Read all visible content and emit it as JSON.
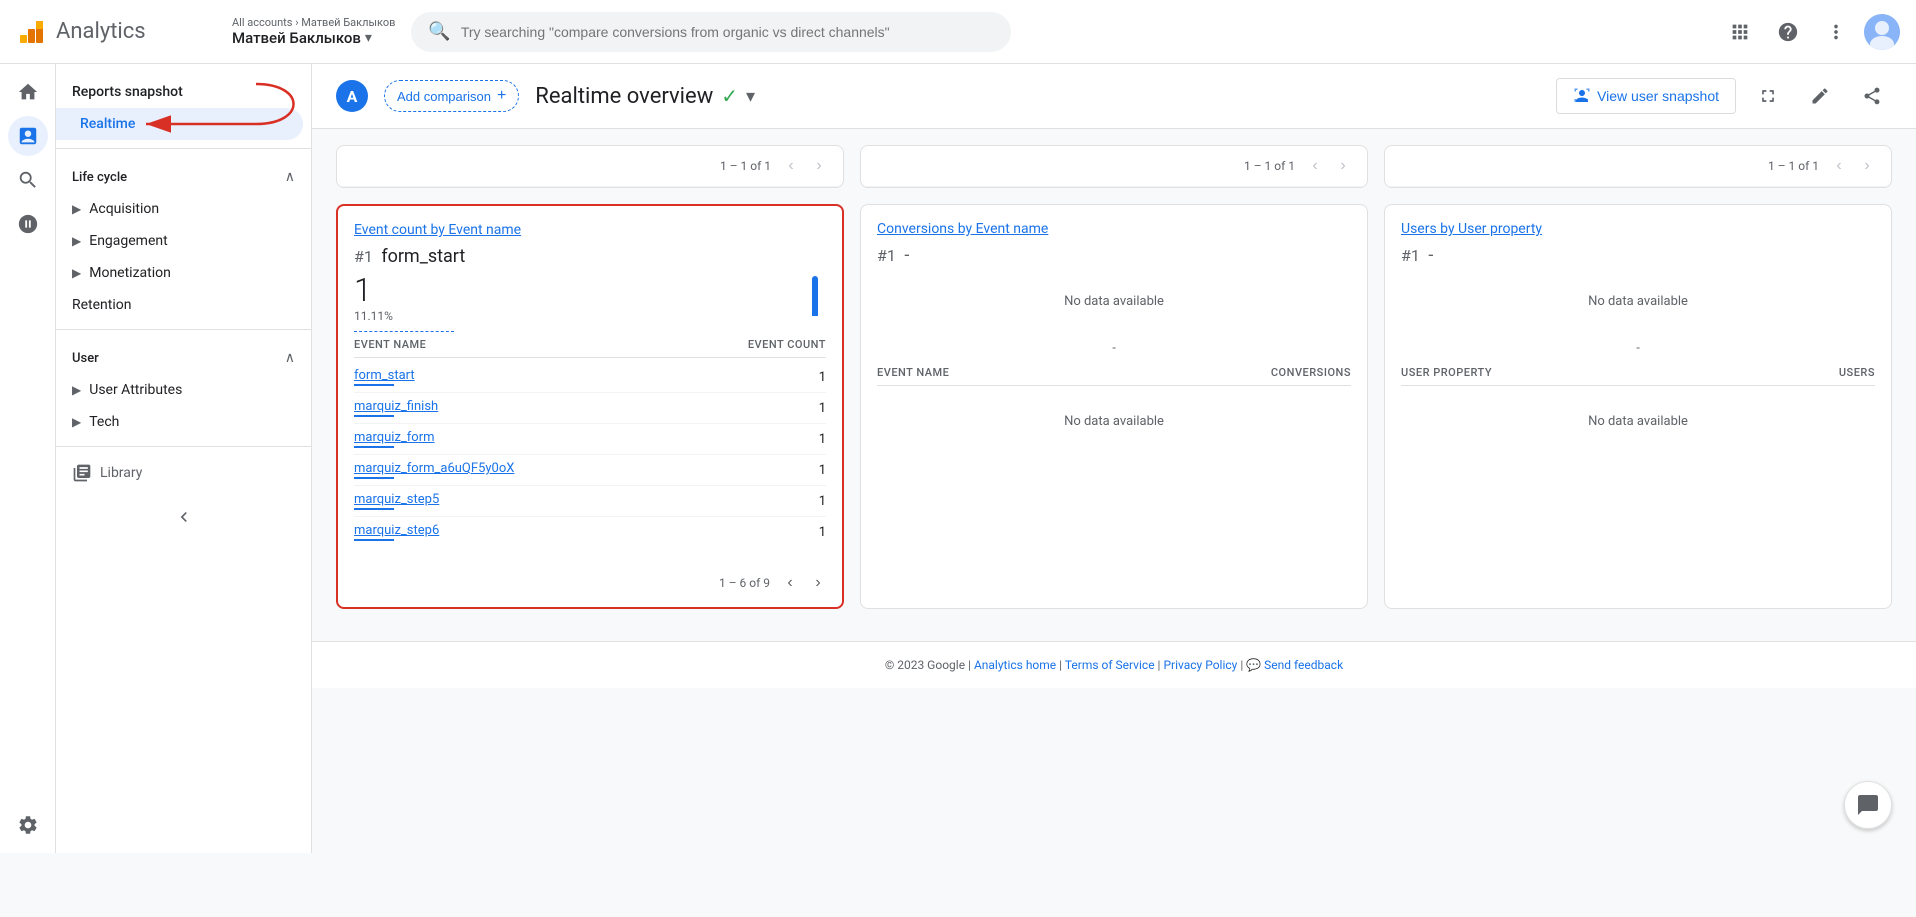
{
  "header": {
    "app_title": "Analytics",
    "breadcrumb_all": "All accounts",
    "breadcrumb_sep": "›",
    "account_name": "Матвей Баклыков",
    "account_name_arrow": "▾",
    "search_placeholder": "Try searching \"compare conversions from organic vs direct channels\"",
    "apps_icon": "⊞",
    "help_icon": "?",
    "more_icon": "⋮"
  },
  "sidebar": {
    "reports_snapshot": "Reports snapshot",
    "realtime": "Realtime",
    "lifecycle_title": "Life cycle",
    "lifecycle_items": [
      {
        "label": "Acquisition",
        "expandable": true
      },
      {
        "label": "Engagement",
        "expandable": true
      },
      {
        "label": "Monetization",
        "expandable": true
      },
      {
        "label": "Retention",
        "expandable": false
      }
    ],
    "user_title": "User",
    "user_items": [
      {
        "label": "User Attributes",
        "expandable": true
      },
      {
        "label": "Tech",
        "expandable": true
      }
    ],
    "library": "Library"
  },
  "content": {
    "add_comparison_label": "Add comparison",
    "add_comparison_icon": "+",
    "page_title": "Realtime overview",
    "view_snapshot_label": "View user snapshot",
    "cards_row1": {
      "pagination_label": "1 – 1 of 1",
      "prev_disabled": true,
      "next_disabled": true
    },
    "event_count_card": {
      "title": "Event count by Event name",
      "top_rank": "#1",
      "top_name": "form_start",
      "metric_value": "1",
      "metric_percent": "11.11%",
      "col1": "EVENT NAME",
      "col2": "EVENT COUNT",
      "rows": [
        {
          "name": "form_start",
          "value": "1"
        },
        {
          "name": "marquiz_finish",
          "value": "1"
        },
        {
          "name": "marquiz_form",
          "value": "1"
        },
        {
          "name": "marquiz_form_a6uQF5y0oX",
          "value": "1"
        },
        {
          "name": "marquiz_step5",
          "value": "1"
        },
        {
          "name": "marquiz_step6",
          "value": "1"
        }
      ],
      "footer_pagination": "1 – 6 of 9"
    },
    "conversions_card": {
      "title": "Conversions by Event name",
      "top_rank": "#1",
      "top_dash": "-",
      "col1": "EVENT NAME",
      "col2": "CONVERSIONS",
      "no_data": "No data available",
      "dash": "-"
    },
    "users_card": {
      "title": "Users by User property",
      "top_rank": "#1",
      "top_dash": "-",
      "col1": "USER PROPERTY",
      "col2": "USERS",
      "no_data": "No data available",
      "dash": "-"
    }
  },
  "footer": {
    "copyright": "© 2023 Google",
    "analytics_home": "Analytics home",
    "terms": "Terms of Service",
    "privacy": "Privacy Policy",
    "feedback_icon": "💬",
    "feedback": "Send feedback",
    "sep": "|"
  }
}
